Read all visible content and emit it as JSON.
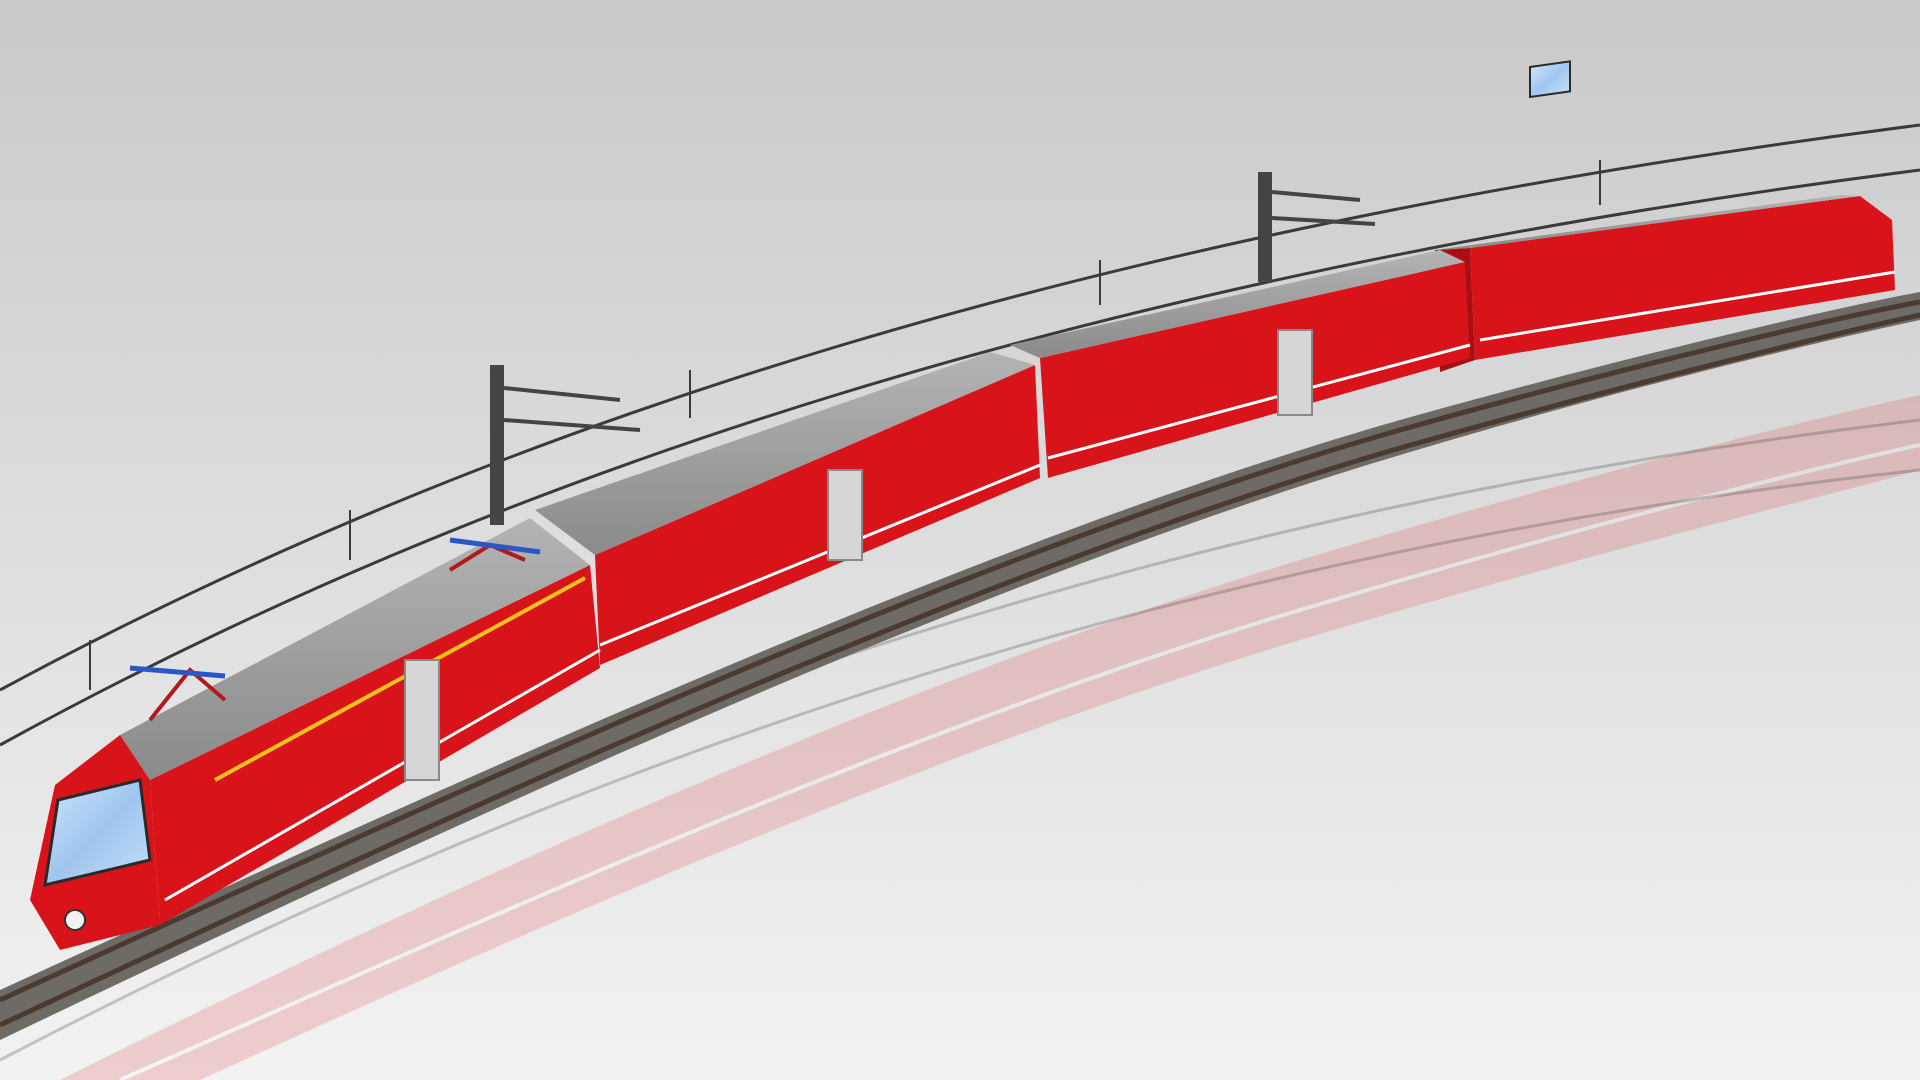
{
  "scene": {
    "subject": "red-electric-multiple-unit-train",
    "cars": 4,
    "colors": {
      "background_top": "#c9c9c9",
      "background_bottom": "#f2f2f2",
      "body_red": "#d8141a",
      "body_red_dark": "#a80e12",
      "roof_grey": "#9c9c9c",
      "roof_grey_dark": "#7c7c7c",
      "window_blue": "#a9cdf2",
      "window_frame": "#2a2a2a",
      "stripe_yellow": "#f2c21a",
      "stripe_white": "#ffffff",
      "ballast": "#6e6a66",
      "catenary": "#3a3a3a",
      "door_grey": "#d6d6d6"
    }
  }
}
